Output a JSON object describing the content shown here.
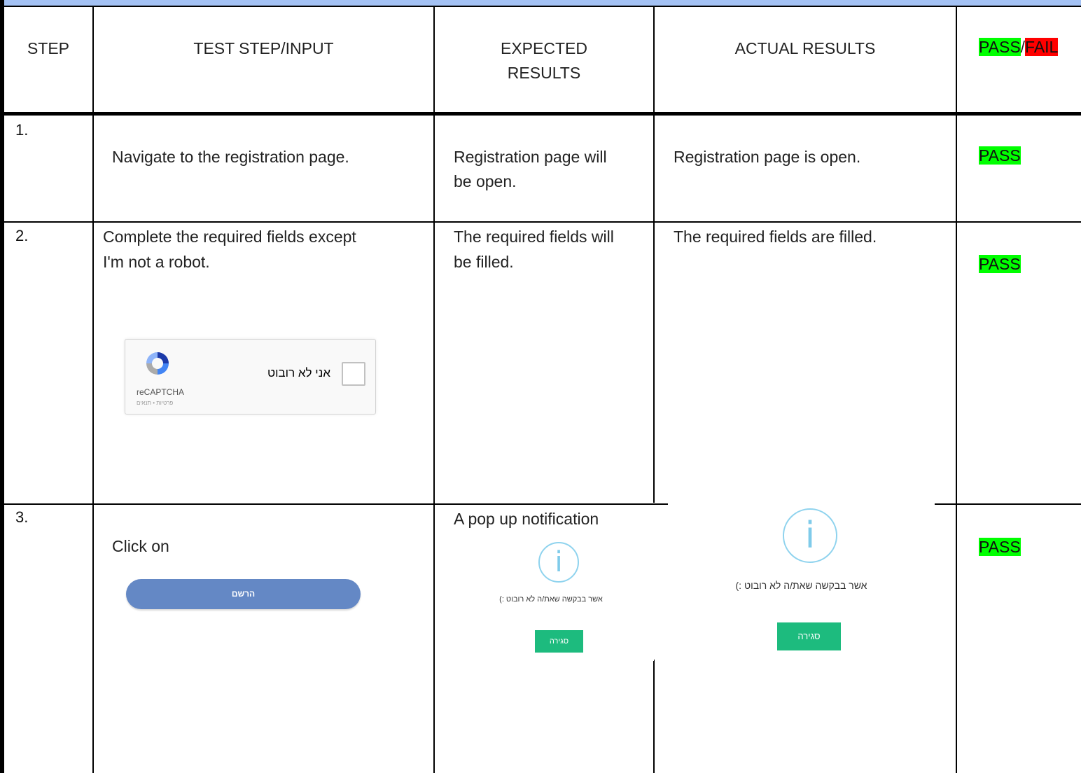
{
  "header": {
    "step": "STEP",
    "test_step": "TEST STEP/INPUT",
    "expected_line1": "EXPECTED",
    "expected_line2": "RESULTS",
    "actual": "ACTUAL RESULTS",
    "pass": "PASS",
    "slash": "/",
    "fail": "FAIL"
  },
  "rows": [
    {
      "num": "1.",
      "input": "Navigate to the registration page.",
      "expected_line1": "Registration page will",
      "expected_line2": "be open.",
      "actual": "Registration page is open.",
      "result": "PASS"
    },
    {
      "num": "2.",
      "input_line1": "Complete the required fields except",
      "input_line2": "I'm not a robot.",
      "expected_line1": "The required fields will",
      "expected_line2": "be filled.",
      "actual": "The required fields are filled.",
      "result": "PASS"
    },
    {
      "num": "3.",
      "input": "Click on",
      "expected_line1": "A pop up notification",
      "result": "PASS"
    }
  ],
  "recaptcha": {
    "label": "אני לא רובוט",
    "brand": "reCAPTCHA",
    "sub": "פרטיות • תנאים"
  },
  "register_button": {
    "label": "הרשם"
  },
  "popup": {
    "icon": "i",
    "message": "אשר בבקשה שאת/ה לא רובוט :)",
    "close": "סגירה"
  },
  "colors": {
    "pass": "#00ff00",
    "fail": "#ff0000",
    "header_band": "#a4c2f4",
    "register": "#6488c5",
    "close": "#1dbb7e"
  }
}
